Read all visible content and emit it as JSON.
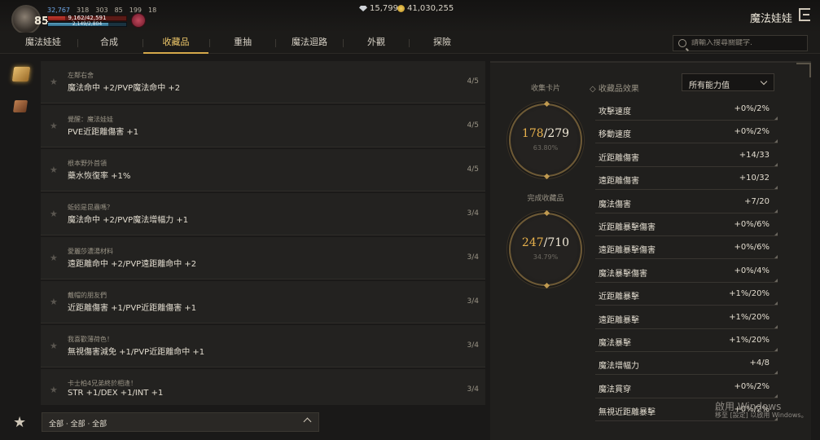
{
  "player": {
    "level": "85",
    "stats": [
      "32,767",
      "318",
      "303",
      "85",
      "199",
      "18"
    ],
    "hp_text": "9,162/42,591",
    "mp_text": "2,149/2,804",
    "hp_fraction": 0.22,
    "mp_fraction": 0.77
  },
  "currency": {
    "diamonds": "15,799",
    "gold": "41,030,255"
  },
  "header": {
    "title": "魔法娃娃"
  },
  "tabs": [
    {
      "label": "魔法娃娃"
    },
    {
      "label": "合成"
    },
    {
      "label": "收藏品",
      "active": true
    },
    {
      "label": "重抽"
    },
    {
      "label": "魔法迴路"
    },
    {
      "label": "外觀"
    },
    {
      "label": "探險"
    }
  ],
  "search": {
    "placeholder": "請輸入搜尋關鍵字."
  },
  "collection_list": [
    {
      "name": "左鄰右舍",
      "effect": "魔法命中 +2/PVP魔法命中 +2",
      "count": "4/5"
    },
    {
      "name": "覺醒：魔法娃娃",
      "effect": "PVE近距離傷害 +1",
      "count": "4/5"
    },
    {
      "name": "根本野外首領",
      "effect": "藥水恢復率 +1%",
      "count": "4/5"
    },
    {
      "name": "蚯蚓是昆蟲嗎？",
      "effect": "魔法命中 +2/PVP魔法增幅力 +1",
      "count": "3/4"
    },
    {
      "name": "愛麗莎濃湯材料",
      "effect": "遠距離命中 +2/PVP遠距離命中 +2",
      "count": "3/4"
    },
    {
      "name": "戴帽的朋友們",
      "effect": "近距離傷害 +1/PVP近距離傷害 +1",
      "count": "3/4"
    },
    {
      "name": "我喜歡薄荷色！",
      "effect": "無視傷害減免 +1/PVP近距離命中 +1",
      "count": "3/4"
    },
    {
      "name": "卡士柏4兄弟終於相逢！",
      "effect": "STR +1/DEX +1/INT +1",
      "count": "3/4"
    }
  ],
  "filter": {
    "label": "全部 · 全部 · 全部"
  },
  "summary": {
    "cards_label": "收集卡片",
    "cards_have": "178",
    "cards_total": "/279",
    "cards_pct": "63.80%",
    "done_label": "完成收藏品",
    "done_have": "247",
    "done_total": "/710",
    "done_pct": "34.79%"
  },
  "effects": {
    "heading": "收藏品效果",
    "dropdown_value": "所有能力值",
    "rows": [
      {
        "label": "攻擊速度",
        "value": "+0%/2%"
      },
      {
        "label": "移動速度",
        "value": "+0%/2%"
      },
      {
        "label": "近距離傷害",
        "value": "+14/33"
      },
      {
        "label": "遠距離傷害",
        "value": "+10/32"
      },
      {
        "label": "魔法傷害",
        "value": "+7/20"
      },
      {
        "label": "近距離暴擊傷害",
        "value": "+0%/6%"
      },
      {
        "label": "遠距離暴擊傷害",
        "value": "+0%/6%"
      },
      {
        "label": "魔法暴擊傷害",
        "value": "+0%/4%"
      },
      {
        "label": "近距離暴擊",
        "value": "+1%/20%"
      },
      {
        "label": "遠距離暴擊",
        "value": "+1%/20%"
      },
      {
        "label": "魔法暴擊",
        "value": "+1%/20%"
      },
      {
        "label": "魔法增幅力",
        "value": "+4/8"
      },
      {
        "label": "魔法貫穿",
        "value": "+0%/2%"
      },
      {
        "label": "無視近距離暴擊",
        "value": "+0%/2%"
      }
    ]
  },
  "watermark": {
    "line1": "啟用 Windows",
    "line2": "移至 [設定] 以啟用 Windows。"
  }
}
